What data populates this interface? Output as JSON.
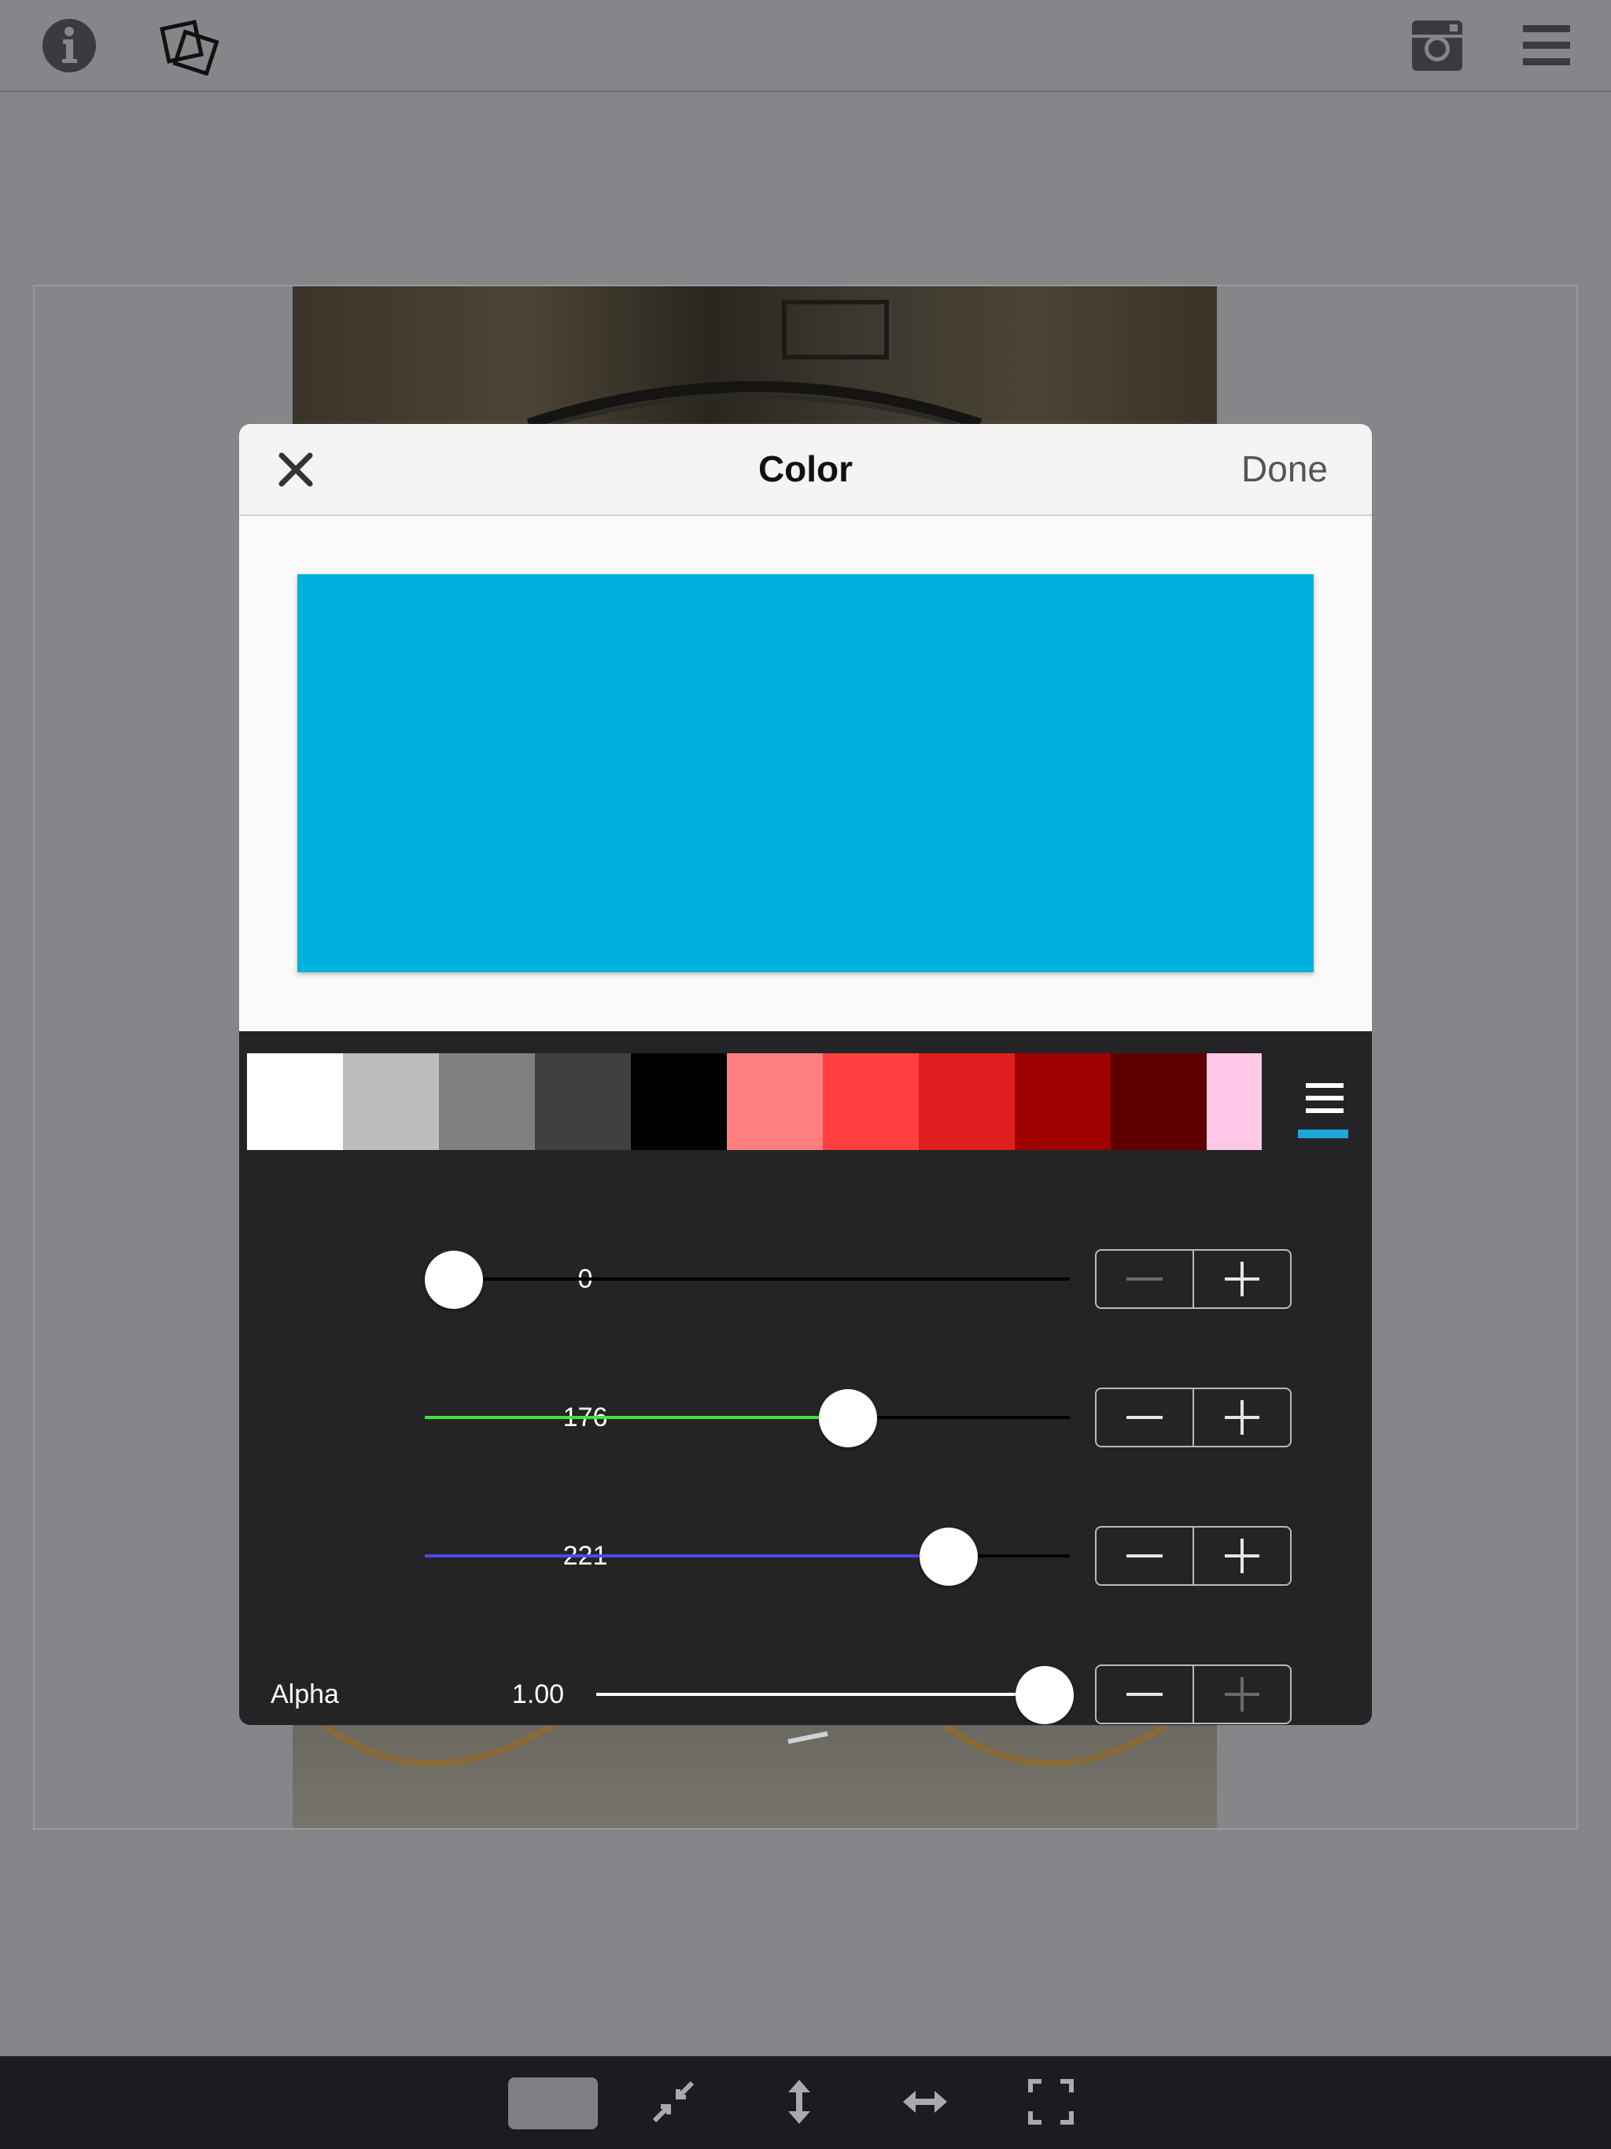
{
  "toolbar": {
    "icons": [
      "info-icon",
      "layers-icon",
      "instagram-icon",
      "menu-icon"
    ]
  },
  "modal": {
    "title": "Color",
    "done_label": "Done",
    "close_icon": "close-icon",
    "preview_color": "#00b0dd"
  },
  "palette": {
    "swatches": [
      "#ffffff",
      "#bdbdbd",
      "#808080",
      "#404040",
      "#000000",
      "#ff7f7f",
      "#ff3f3f",
      "#df1f1f",
      "#9f0000",
      "#5f0000",
      "#ffc8e8"
    ],
    "menu_icon": "menu-icon",
    "accent": "#1aa7d9"
  },
  "sliders": [
    {
      "value_text": "0",
      "value": 0,
      "max": 255,
      "fill_color": "#000000"
    },
    {
      "value_text": "176",
      "value": 176,
      "max": 255,
      "fill_color": "#3ce63c"
    },
    {
      "value_text": "221",
      "value": 221,
      "max": 255,
      "fill_color": "#4a4af0"
    }
  ],
  "alpha": {
    "label": "Alpha",
    "value_text": "1.00",
    "value": 1.0,
    "fill_color": "#ffffff"
  },
  "bottom_bar": {
    "icons": [
      "aspect-ratio-icon",
      "shrink-icon",
      "vertical-stretch-icon",
      "horizontal-stretch-icon",
      "fullscreen-icon"
    ]
  }
}
